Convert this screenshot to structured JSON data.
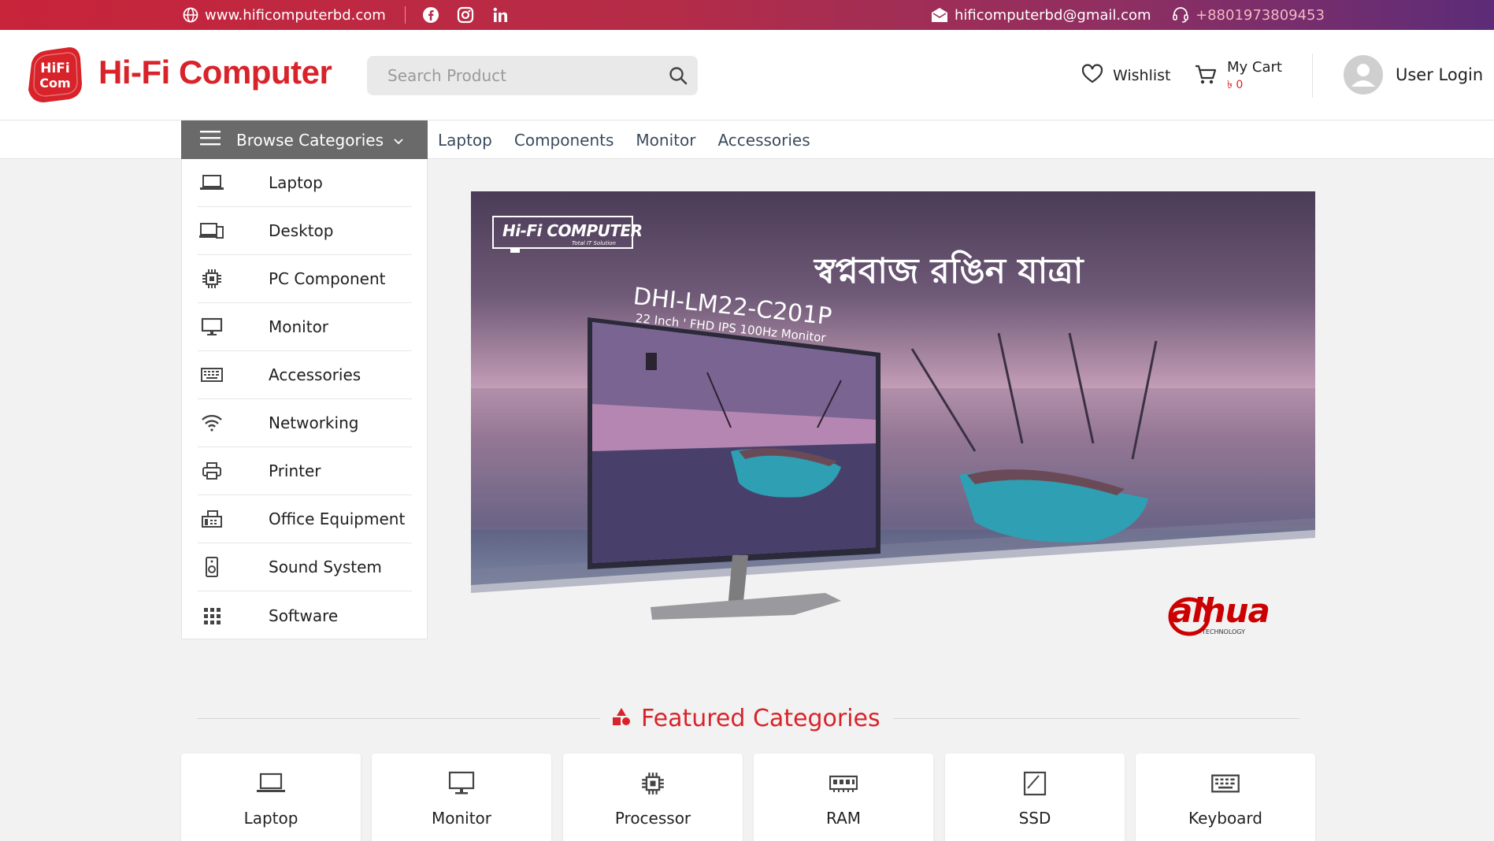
{
  "topbar": {
    "website": "www.hificomputerbd.com",
    "email": "hificomputerbd@gmail.com",
    "phone": "+8801973809453",
    "social": [
      "facebook-icon",
      "instagram-icon",
      "linkedin-icon"
    ]
  },
  "header": {
    "logo_text_top": "HiFi",
    "logo_text_bottom": "Com",
    "brand": "Hi-Fi Computer",
    "search_placeholder": "Search Product",
    "wishlist_label": "Wishlist",
    "cart_label": "My Cart",
    "cart_amount": "৳ 0",
    "login_label": "User Login"
  },
  "nav": {
    "browse_label": "Browse Categories",
    "links": [
      "Laptop",
      "Components",
      "Monitor",
      "Accessories"
    ]
  },
  "sidebar": {
    "categories": [
      {
        "label": "Laptop",
        "icon": "laptop-icon"
      },
      {
        "label": "Desktop",
        "icon": "desktop-icon"
      },
      {
        "label": "PC Component",
        "icon": "chip-icon"
      },
      {
        "label": "Monitor",
        "icon": "monitor-icon"
      },
      {
        "label": "Accessories",
        "icon": "keyboard-icon"
      },
      {
        "label": "Networking",
        "icon": "wifi-icon"
      },
      {
        "label": "Printer",
        "icon": "printer-icon"
      },
      {
        "label": "Office Equipment",
        "icon": "fax-icon"
      },
      {
        "label": "Sound System",
        "icon": "speaker-icon"
      },
      {
        "label": "Software",
        "icon": "grid-icon"
      }
    ]
  },
  "banner": {
    "brand": "Hi-Fi COMPUTER",
    "brand_sub": "Total IT Solution",
    "headline": "স্বপ্নবাজ রঙিন যাত্রা",
    "model": "DHI-LM22-C201P",
    "spec": "22 Inch ' FHD IPS 100Hz Monitor",
    "maker": "alhua",
    "maker_sub": "TECHNOLOGY"
  },
  "featured": {
    "title": "Featured Categories",
    "items": [
      {
        "label": "Laptop",
        "icon": "laptop-icon"
      },
      {
        "label": "Monitor",
        "icon": "monitor-icon"
      },
      {
        "label": "Processor",
        "icon": "chip-icon"
      },
      {
        "label": "RAM",
        "icon": "ram-icon"
      },
      {
        "label": "SSD",
        "icon": "ssd-icon"
      },
      {
        "label": "Keyboard",
        "icon": "keyboard-icon"
      }
    ]
  },
  "colors": {
    "brand_red": "#d8232a",
    "topbar_start": "#c8243a",
    "topbar_end": "#5c2c78",
    "browse_bg": "#6a6a6a"
  }
}
